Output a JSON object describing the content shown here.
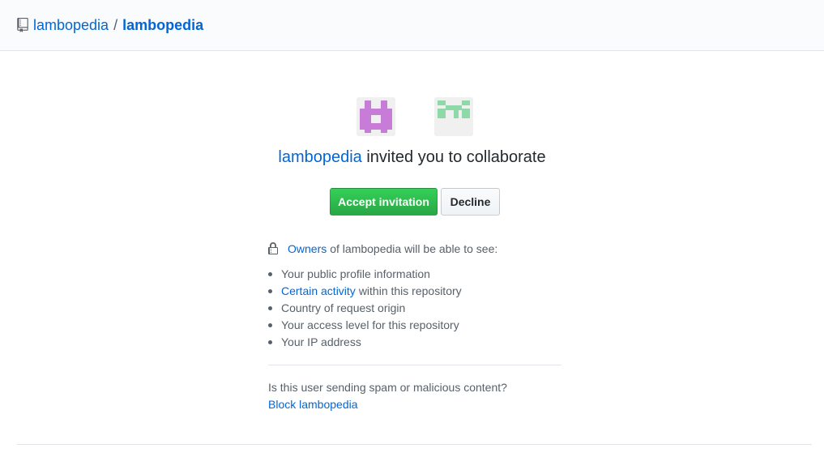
{
  "header": {
    "owner": "lambopedia",
    "separator": "/",
    "repo": "lambopedia",
    "icon": "repo-icon"
  },
  "avatars": {
    "left": {
      "icon": "identicon-purple",
      "color": "#c77dd8"
    },
    "right": {
      "icon": "identicon-green",
      "color": "#8fd9a8"
    }
  },
  "invite": {
    "inviter": "lambopedia",
    "headline_rest": "invited you to collaborate",
    "accept_label": "Accept invitation",
    "decline_label": "Decline"
  },
  "visibility": {
    "owners_link": "Owners",
    "owners_rest": "of lambopedia will be able to see:",
    "items": [
      {
        "text": "Your public profile information"
      },
      {
        "link": "Certain activity",
        "text": "within this repository"
      },
      {
        "text": "Country of request origin"
      },
      {
        "text": "Your access level for this repository"
      },
      {
        "text": "Your IP address"
      }
    ]
  },
  "spam": {
    "question": "Is this user sending spam or malicious content?",
    "block_label": "Block lambopedia"
  },
  "colors": {
    "link": "#0366d6",
    "accept": "#2cbe4e",
    "text": "#24292e",
    "muted": "#586069"
  }
}
